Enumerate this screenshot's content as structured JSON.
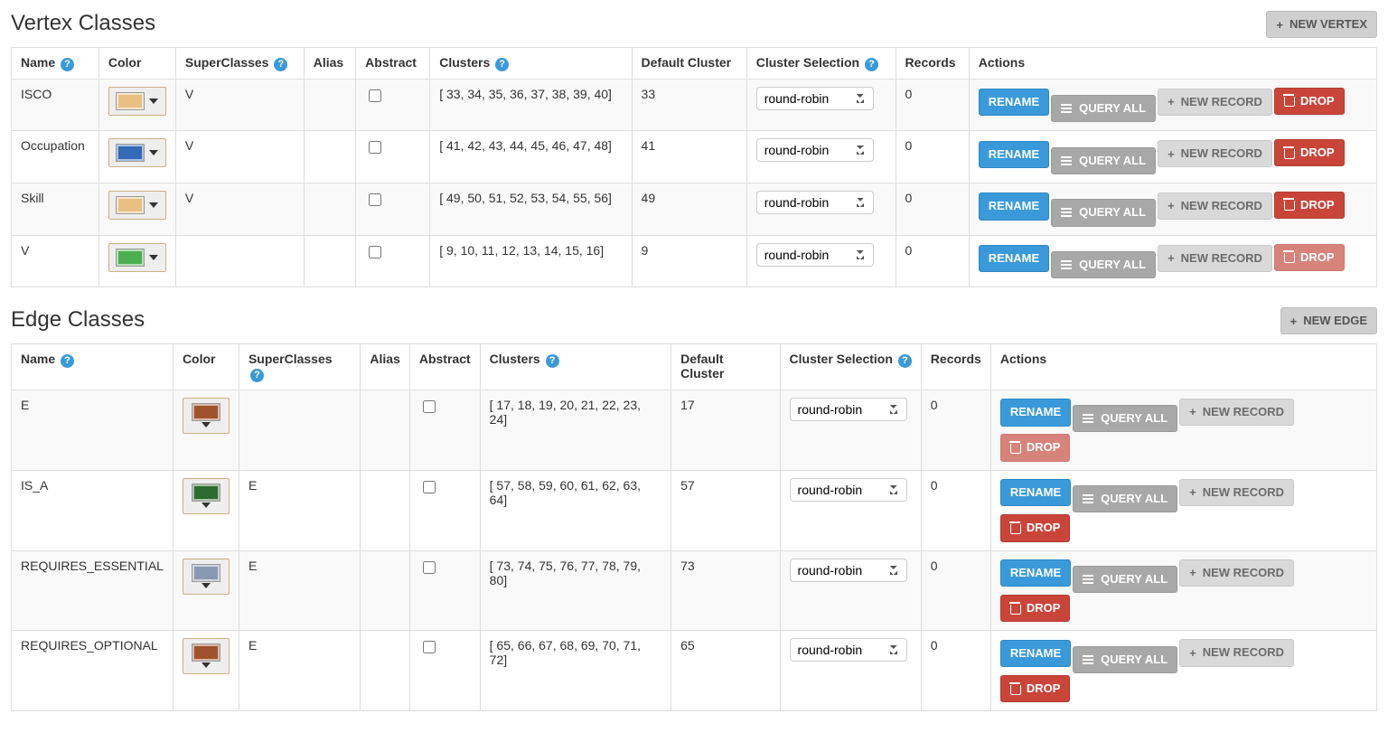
{
  "labels": {
    "help": "?",
    "clusterSelectionOptions": [
      "round-robin"
    ]
  },
  "buttons": {
    "rename": "RENAME",
    "queryAll": "QUERY ALL",
    "newRecord": "NEW RECORD",
    "drop": "DROP",
    "newVertex": "NEW VERTEX",
    "newEdge": "NEW EDGE"
  },
  "headers": {
    "name": "Name",
    "color": "Color",
    "superClasses": "SuperClasses",
    "alias": "Alias",
    "abstract": "Abstract",
    "clusters": "Clusters",
    "defaultCluster": "Default Cluster",
    "clusterSelection": "Cluster Selection",
    "records": "Records",
    "actions": "Actions"
  },
  "vertexSection": {
    "title": "Vertex Classes",
    "rows": [
      {
        "name": "ISCO",
        "color": "#e8c083",
        "superClasses": "V",
        "alias": "",
        "abstract": false,
        "clusters": "[ 33, 34, 35, 36, 37, 38, 39, 40]",
        "defaultCluster": "33",
        "clusterSelection": "round-robin",
        "records": "0",
        "dropDim": false
      },
      {
        "name": "Occupation",
        "color": "#3369b5",
        "superClasses": "V",
        "alias": "",
        "abstract": false,
        "clusters": "[ 41, 42, 43, 44, 45, 46, 47, 48]",
        "defaultCluster": "41",
        "clusterSelection": "round-robin",
        "records": "0",
        "dropDim": false
      },
      {
        "name": "Skill",
        "color": "#e8c083",
        "superClasses": "V",
        "alias": "",
        "abstract": false,
        "clusters": "[ 49, 50, 51, 52, 53, 54, 55, 56]",
        "defaultCluster": "49",
        "clusterSelection": "round-robin",
        "records": "0",
        "dropDim": false
      },
      {
        "name": "V",
        "color": "#4caf50",
        "superClasses": "",
        "alias": "",
        "abstract": false,
        "clusters": "[ 9, 10, 11, 12, 13, 14, 15, 16]",
        "defaultCluster": "9",
        "clusterSelection": "round-robin",
        "records": "0",
        "dropDim": true
      }
    ]
  },
  "edgeSection": {
    "title": "Edge Classes",
    "rows": [
      {
        "name": "E",
        "color": "#a0522d",
        "superClasses": "",
        "alias": "",
        "abstract": false,
        "clusters": "[ 17, 18, 19, 20, 21, 22, 23, 24]",
        "defaultCluster": "17",
        "clusterSelection": "round-robin",
        "records": "0",
        "dropDim": true
      },
      {
        "name": "IS_A",
        "color": "#2e6b2e",
        "superClasses": "E",
        "alias": "",
        "abstract": false,
        "clusters": "[ 57, 58, 59, 60, 61, 62, 63, 64]",
        "defaultCluster": "57",
        "clusterSelection": "round-robin",
        "records": "0",
        "dropDim": false
      },
      {
        "name": "REQUIRES_ESSENTIAL",
        "color": "#8a99b3",
        "superClasses": "E",
        "alias": "",
        "abstract": false,
        "clusters": "[ 73, 74, 75, 76, 77, 78, 79, 80]",
        "defaultCluster": "73",
        "clusterSelection": "round-robin",
        "records": "0",
        "dropDim": false
      },
      {
        "name": "REQUIRES_OPTIONAL",
        "color": "#a0522d",
        "superClasses": "E",
        "alias": "",
        "abstract": false,
        "clusters": "[ 65, 66, 67, 68, 69, 70, 71, 72]",
        "defaultCluster": "65",
        "clusterSelection": "round-robin",
        "records": "0",
        "dropDim": false
      }
    ]
  }
}
